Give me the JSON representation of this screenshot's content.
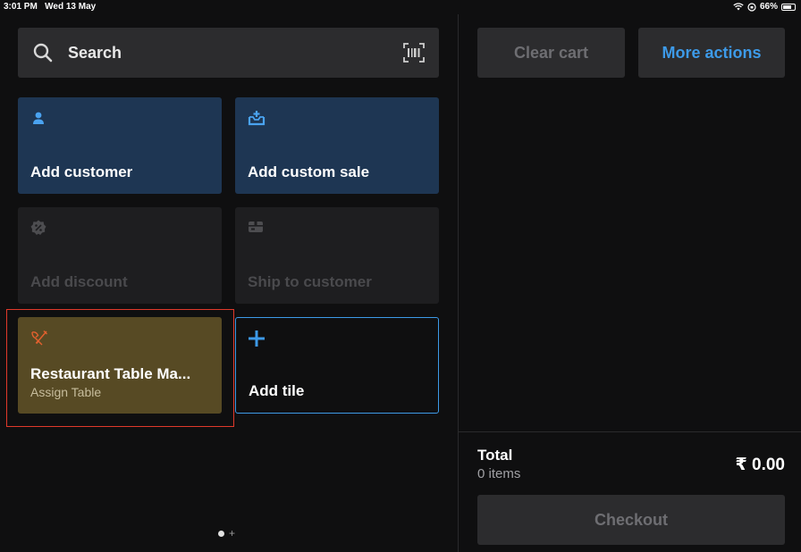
{
  "status_bar": {
    "time": "3:01 PM",
    "date": "Wed 13 May",
    "battery": "66%",
    "battery_level": 0.66
  },
  "search": {
    "label": "Search",
    "icon": "search-icon",
    "scan_icon": "barcode-icon"
  },
  "tiles": [
    {
      "title": "Add customer",
      "icon": "person-icon",
      "state": "enabled"
    },
    {
      "title": "Add custom sale",
      "icon": "tray-plus-icon",
      "state": "enabled"
    },
    {
      "title": "Add discount",
      "icon": "discount-badge-icon",
      "state": "disabled"
    },
    {
      "title": "Ship to customer",
      "icon": "package-icon",
      "state": "disabled"
    },
    {
      "title": "Restaurant Table Ma...",
      "subtitle": "Assign Table",
      "icon": "utensils-icon",
      "state": "enabled"
    },
    {
      "title": "Add tile",
      "icon": "plus-icon",
      "state": "enabled"
    }
  ],
  "pager": {
    "pages": 1,
    "current": 1
  },
  "actions": {
    "clear_cart": "Clear cart",
    "more_actions": "More actions"
  },
  "cart": {
    "total_label": "Total",
    "items_label": "0 items",
    "amount": "₹ 0.00",
    "checkout_label": "Checkout"
  },
  "colors": {
    "accent": "#3d9ae8",
    "tile_blue": "#1e3653",
    "tile_olive": "#574a24",
    "highlight": "#e0392b"
  }
}
